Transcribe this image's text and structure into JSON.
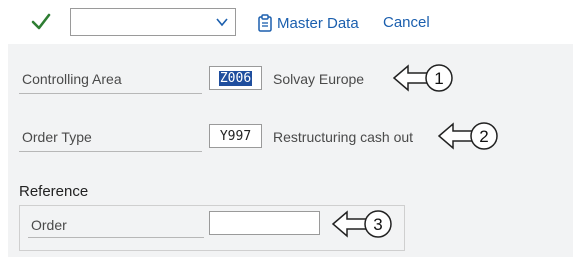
{
  "toolbar": {
    "dropdown_value": "",
    "master_data_label": "Master Data",
    "cancel_label": "Cancel"
  },
  "form": {
    "controlling_area": {
      "label": "Controlling Area",
      "value": "Z006",
      "description": "Solvay Europe"
    },
    "order_type": {
      "label": "Order Type",
      "value": "Y997",
      "description": "Restructuring cash out"
    },
    "reference": {
      "title": "Reference",
      "order_label": "Order",
      "order_value": ""
    }
  },
  "callouts": [
    "1",
    "2",
    "3"
  ],
  "colors": {
    "link": "#1b5fae",
    "check": "#2e7d32",
    "selection": "#1f4e9e"
  }
}
